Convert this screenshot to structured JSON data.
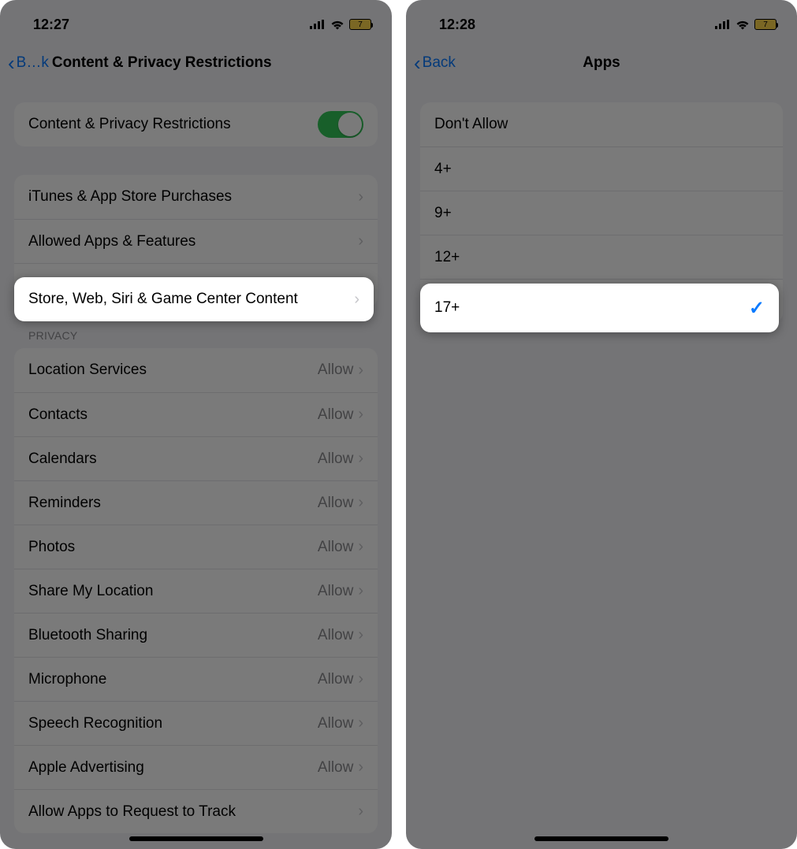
{
  "left": {
    "status": {
      "time": "12:27",
      "battery": "7"
    },
    "nav": {
      "back": "B…k",
      "title": "Content & Privacy Restrictions"
    },
    "toggle_row": {
      "label": "Content & Privacy Restrictions"
    },
    "group1": [
      {
        "label": "iTunes & App Store Purchases"
      },
      {
        "label": "Allowed Apps & Features"
      },
      {
        "label": "Store, Web, Siri & Game Center Content"
      }
    ],
    "privacy_header": "PRIVACY",
    "privacy_rows": [
      {
        "label": "Location Services",
        "value": "Allow"
      },
      {
        "label": "Contacts",
        "value": "Allow"
      },
      {
        "label": "Calendars",
        "value": "Allow"
      },
      {
        "label": "Reminders",
        "value": "Allow"
      },
      {
        "label": "Photos",
        "value": "Allow"
      },
      {
        "label": "Share My Location",
        "value": "Allow"
      },
      {
        "label": "Bluetooth Sharing",
        "value": "Allow"
      },
      {
        "label": "Microphone",
        "value": "Allow"
      },
      {
        "label": "Speech Recognition",
        "value": "Allow"
      },
      {
        "label": "Apple Advertising",
        "value": "Allow"
      },
      {
        "label": "Allow Apps to Request to Track",
        "value": ""
      }
    ],
    "highlight_index": 2
  },
  "right": {
    "status": {
      "time": "12:28",
      "battery": "7"
    },
    "nav": {
      "back": "Back",
      "title": "Apps"
    },
    "rows": [
      {
        "label": "Don't Allow",
        "checked": false
      },
      {
        "label": "4+",
        "checked": false
      },
      {
        "label": "9+",
        "checked": false
      },
      {
        "label": "12+",
        "checked": false
      },
      {
        "label": "17+",
        "checked": true
      }
    ],
    "highlight_index": 4
  }
}
